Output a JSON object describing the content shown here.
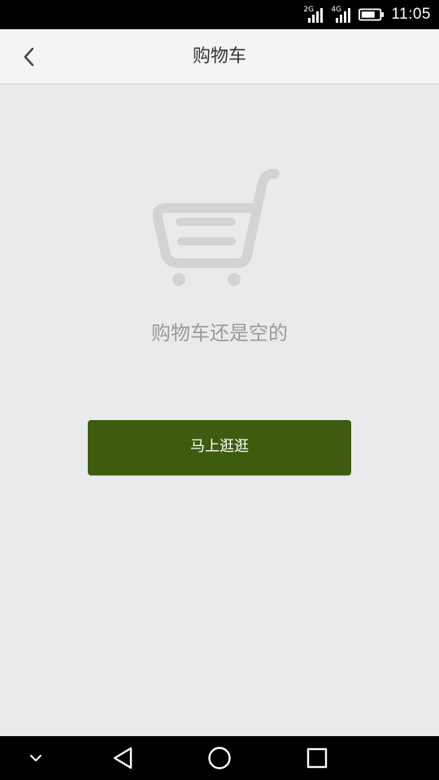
{
  "status_bar": {
    "network_1": "2G",
    "network_2": "4G",
    "time": "11:05"
  },
  "header": {
    "title": "购物车",
    "back_icon": "chevron-left-icon"
  },
  "empty_state": {
    "illustration_icon": "shopping-cart-icon",
    "message": "购物车还是空的",
    "button_label": "马上逛逛"
  },
  "colors": {
    "button_bg": "#3e5c0f",
    "page_bg": "#e9eaec",
    "header_bg": "#f4f4f4",
    "cart_gray": "#d2d3d5"
  },
  "nav_bar": {
    "icons": [
      "collapse-icon",
      "back-triangle-icon",
      "home-circle-icon",
      "recents-square-icon"
    ]
  }
}
